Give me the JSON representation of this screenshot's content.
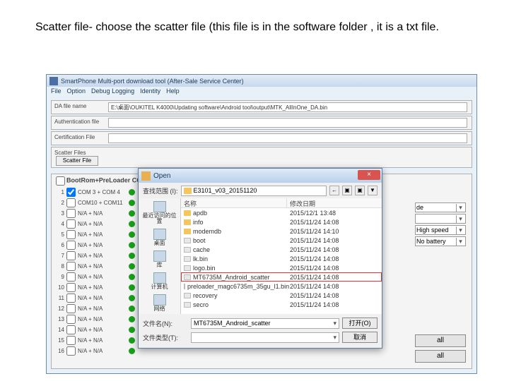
{
  "caption": "Scatter file- choose the scatter file (this file is in the software folder , it is a txt file.",
  "app": {
    "title": "SmartPhone Multi-port download tool (After-Sale Service Center)",
    "menus": [
      "File",
      "Option",
      "Debug Logging",
      "Identity",
      "Help"
    ],
    "da_label": "DA file name",
    "da_value": "E:\\桌面\\OUKITEL K4000\\Updating software\\Android tool\\output\\MTK_AllInOne_DA.bin",
    "auth_label": "Authentication file",
    "cert_label": "Certification File",
    "scatter_group": "Scatter Files",
    "scatter_btn": "Scatter File",
    "bootrom": "BootRom+PreLoader COM",
    "ports": [
      {
        "n": "1",
        "label": "COM 3 + COM 4",
        "chk": true
      },
      {
        "n": "2",
        "label": "COM10 + COM11",
        "chk": false
      },
      {
        "n": "3",
        "label": "N/A + N/A",
        "chk": false
      },
      {
        "n": "4",
        "label": "N/A + N/A",
        "chk": false
      },
      {
        "n": "5",
        "label": "N/A + N/A",
        "chk": false
      },
      {
        "n": "6",
        "label": "N/A + N/A",
        "chk": false
      },
      {
        "n": "7",
        "label": "N/A + N/A",
        "chk": false
      },
      {
        "n": "8",
        "label": "N/A + N/A",
        "chk": false
      },
      {
        "n": "9",
        "label": "N/A + N/A",
        "chk": false
      },
      {
        "n": "10",
        "label": "N/A + N/A",
        "chk": false
      },
      {
        "n": "11",
        "label": "N/A + N/A",
        "chk": false
      },
      {
        "n": "12",
        "label": "N/A + N/A",
        "chk": false
      },
      {
        "n": "13",
        "label": "N/A + N/A",
        "chk": false
      },
      {
        "n": "14",
        "label": "N/A + N/A",
        "chk": false
      },
      {
        "n": "15",
        "label": "N/A + N/A",
        "chk": false
      },
      {
        "n": "16",
        "label": "N/A + N/A",
        "chk": false
      }
    ],
    "side_de": "de",
    "side_hs": "High speed",
    "side_nb": "No battery",
    "btn_all1": "all",
    "btn_all2": "all"
  },
  "dialog": {
    "title": "Open",
    "close": "×",
    "lookin": "查找范围 (I):",
    "folder": "E3101_v03_20151120",
    "nav": [
      "←",
      "▣",
      "▣",
      "▼"
    ],
    "side": [
      {
        "label": "最近访问的位置"
      },
      {
        "label": "桌面"
      },
      {
        "label": "库"
      },
      {
        "label": "计算机"
      },
      {
        "label": "网络"
      }
    ],
    "col1": "名称",
    "col2": "修改日期",
    "files": [
      {
        "name": "apdb",
        "date": "2015/12/1 13:48",
        "t": "folder"
      },
      {
        "name": "info",
        "date": "2015/11/24 14:08",
        "t": "folder"
      },
      {
        "name": "modemdb",
        "date": "2015/11/24 14:10",
        "t": "folder"
      },
      {
        "name": "boot",
        "date": "2015/11/24 14:08",
        "t": "file"
      },
      {
        "name": "cache",
        "date": "2015/11/24 14:08",
        "t": "file"
      },
      {
        "name": "lk.bin",
        "date": "2015/11/24 14:08",
        "t": "file"
      },
      {
        "name": "logo.bin",
        "date": "2015/11/24 14:08",
        "t": "file"
      },
      {
        "name": "MT6735M_Android_scatter",
        "date": "2015/11/24 14:08",
        "t": "file",
        "sel": true
      },
      {
        "name": "preloader_magc6735m_35gu_l1.bin",
        "date": "2015/11/24 14:08",
        "t": "file"
      },
      {
        "name": "recovery",
        "date": "2015/11/24 14:08",
        "t": "file"
      },
      {
        "name": "secro",
        "date": "2015/11/24 14:08",
        "t": "file"
      }
    ],
    "fname_label": "文件名(N):",
    "fname_value": "MT6735M_Android_scatter",
    "ftype_label": "文件类型(T):",
    "open_btn": "打开(O)",
    "cancel_btn": "取消"
  }
}
